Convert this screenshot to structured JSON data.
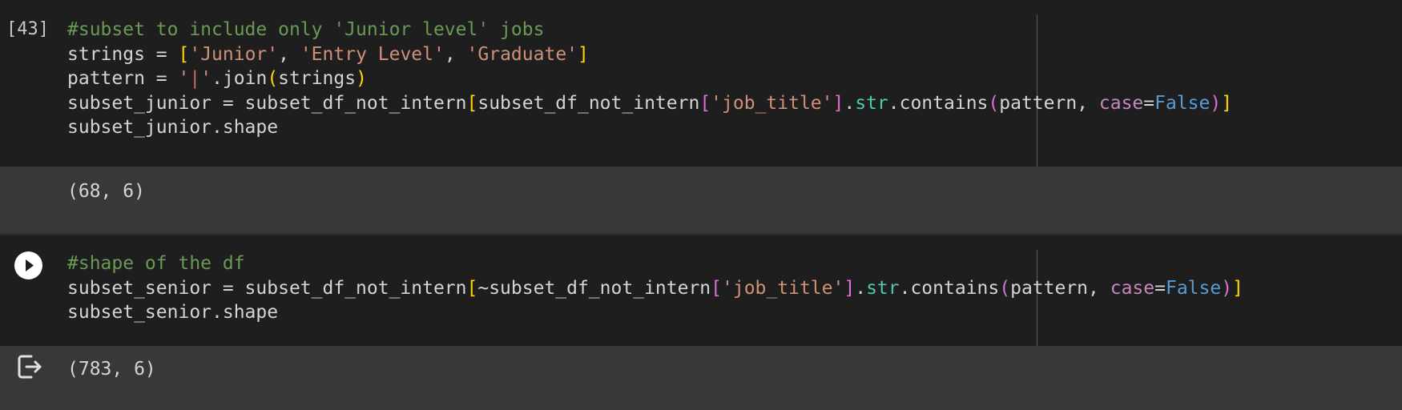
{
  "theme": {
    "comment": "#6a9955",
    "string": "#ce9178",
    "default": "#d4d4d4",
    "bracket_1": "#ffd700",
    "bracket_2": "#da70d6",
    "keyword_arg": "#c586c0",
    "constant": "#569cd6",
    "attribute": "#4ec9b0",
    "pipe": "#d16969"
  },
  "cell1": {
    "execution_count": "[43]",
    "lines": [
      [
        {
          "t": "#subset to include only 'Junior level' jobs",
          "c": "comment"
        }
      ],
      [
        {
          "t": "strings = ",
          "c": "default"
        },
        {
          "t": "[",
          "c": "bracket_1"
        },
        {
          "t": "'Junior'",
          "c": "string"
        },
        {
          "t": ", ",
          "c": "default"
        },
        {
          "t": "'Entry Level'",
          "c": "string"
        },
        {
          "t": ", ",
          "c": "default"
        },
        {
          "t": "'Graduate'",
          "c": "string"
        },
        {
          "t": "]",
          "c": "bracket_1"
        }
      ],
      [
        {
          "t": "pattern = ",
          "c": "default"
        },
        {
          "t": "'",
          "c": "string"
        },
        {
          "t": "|",
          "c": "pipe"
        },
        {
          "t": "'",
          "c": "string"
        },
        {
          "t": ".join",
          "c": "default"
        },
        {
          "t": "(",
          "c": "bracket_1"
        },
        {
          "t": "strings",
          "c": "default"
        },
        {
          "t": ")",
          "c": "bracket_1"
        }
      ],
      [
        {
          "t": "subset_junior = subset_df_not_intern",
          "c": "default"
        },
        {
          "t": "[",
          "c": "bracket_1"
        },
        {
          "t": "subset_df_not_intern",
          "c": "default"
        },
        {
          "t": "[",
          "c": "bracket_2"
        },
        {
          "t": "'job_title'",
          "c": "string"
        },
        {
          "t": "]",
          "c": "bracket_2"
        },
        {
          "t": ".",
          "c": "default"
        },
        {
          "t": "str",
          "c": "attribute"
        },
        {
          "t": ".contains",
          "c": "default"
        },
        {
          "t": "(",
          "c": "bracket_2"
        },
        {
          "t": "pattern, ",
          "c": "default"
        },
        {
          "t": "case",
          "c": "keyword_arg"
        },
        {
          "t": "=",
          "c": "default"
        },
        {
          "t": "False",
          "c": "constant"
        },
        {
          "t": ")",
          "c": "bracket_2"
        },
        {
          "t": "]",
          "c": "bracket_1"
        }
      ],
      [
        {
          "t": "subset_junior.shape",
          "c": "default"
        }
      ]
    ],
    "output": "(68, 6)"
  },
  "cell2": {
    "run_button_label": "Run cell",
    "lines": [
      [
        {
          "t": "#shape of the df",
          "c": "comment"
        }
      ],
      [
        {
          "t": "subset_senior = subset_df_not_intern",
          "c": "default"
        },
        {
          "t": "[",
          "c": "bracket_1"
        },
        {
          "t": "~subset_df_not_intern",
          "c": "default"
        },
        {
          "t": "[",
          "c": "bracket_2"
        },
        {
          "t": "'job_title'",
          "c": "string"
        },
        {
          "t": "]",
          "c": "bracket_2"
        },
        {
          "t": ".",
          "c": "default"
        },
        {
          "t": "str",
          "c": "attribute"
        },
        {
          "t": ".contains",
          "c": "default"
        },
        {
          "t": "(",
          "c": "bracket_2"
        },
        {
          "t": "pattern, ",
          "c": "default"
        },
        {
          "t": "case",
          "c": "keyword_arg"
        },
        {
          "t": "=",
          "c": "default"
        },
        {
          "t": "False",
          "c": "constant"
        },
        {
          "t": ")",
          "c": "bracket_2"
        },
        {
          "t": "]",
          "c": "bracket_1"
        }
      ],
      [
        {
          "t": "subset_senior.shape",
          "c": "default"
        }
      ]
    ],
    "output_icon": "output-redirect-icon",
    "output": "(783, 6)"
  }
}
